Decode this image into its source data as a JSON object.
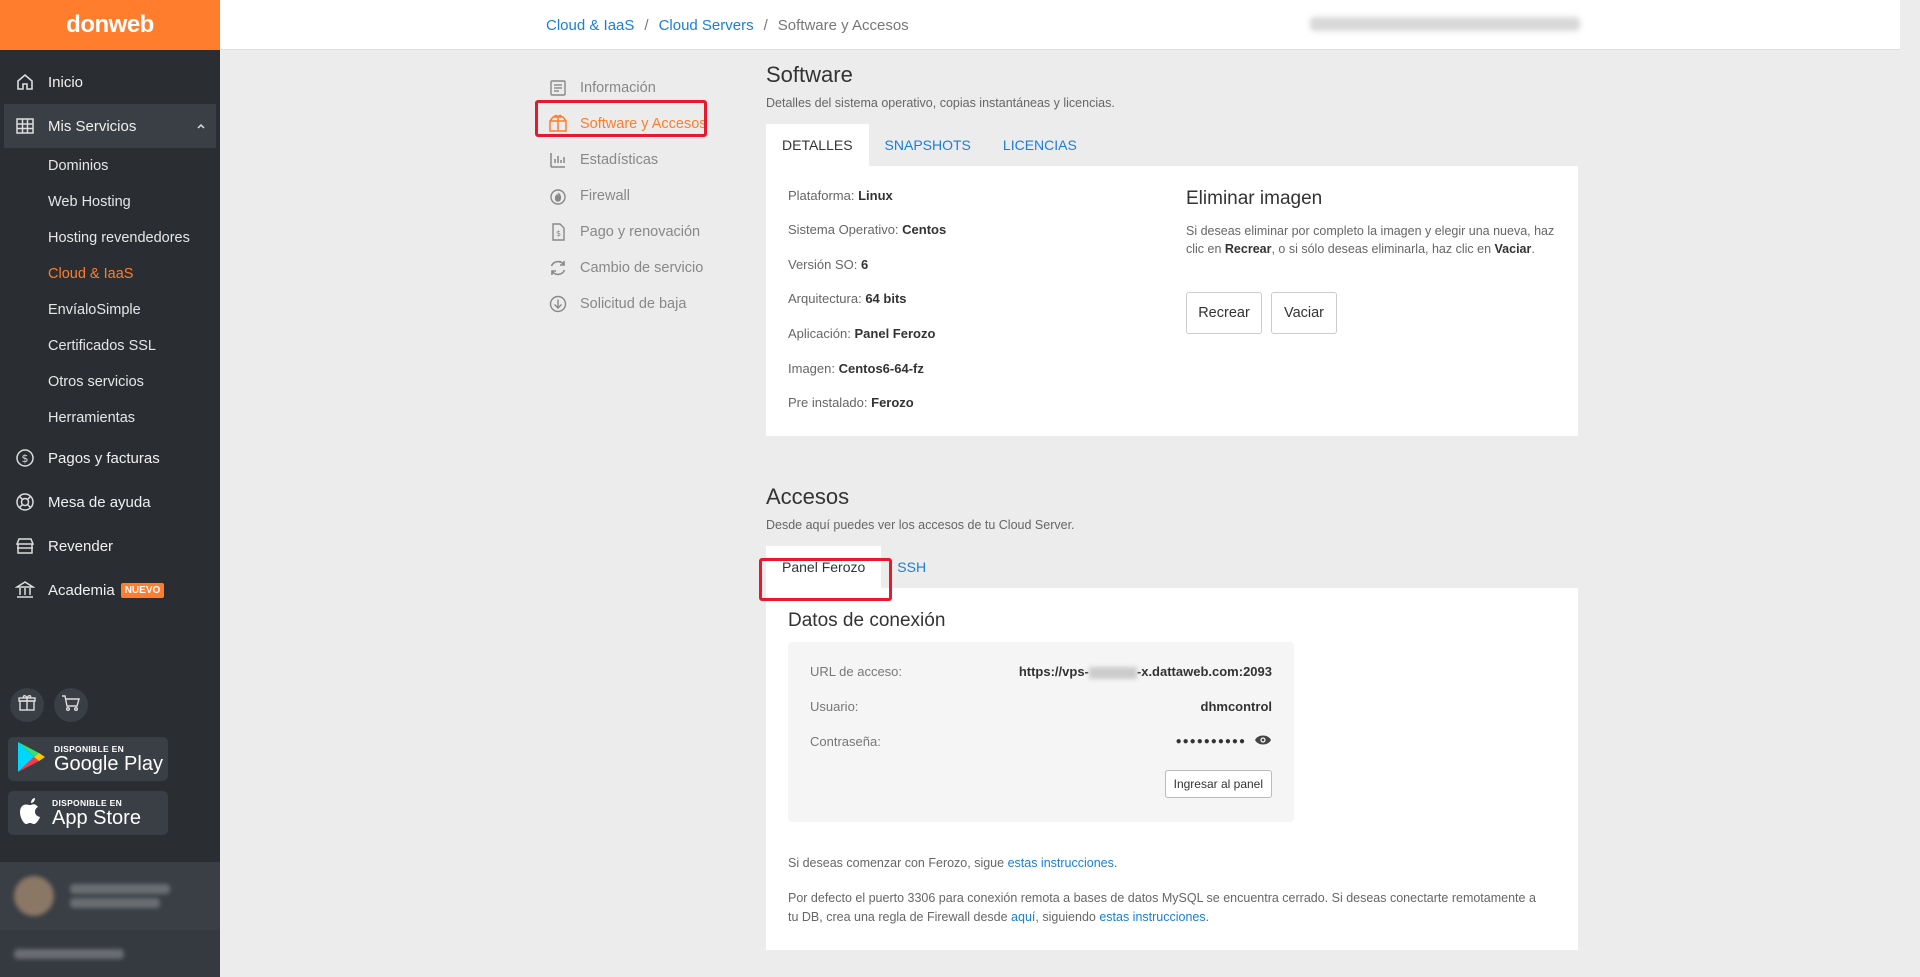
{
  "brand": "donweb",
  "sidebar": {
    "items": [
      {
        "label": "Inicio",
        "icon": "home-icon"
      },
      {
        "label": "Mis Servicios",
        "icon": "grid-icon"
      },
      {
        "label": "Pagos y facturas",
        "icon": "dollar-icon"
      },
      {
        "label": "Mesa de ayuda",
        "icon": "lifebuoy-icon"
      },
      {
        "label": "Revender",
        "icon": "store-icon"
      },
      {
        "label": "Academia",
        "icon": "bank-icon",
        "badge": "NUEVO"
      }
    ],
    "sub_items": [
      "Dominios",
      "Web Hosting",
      "Hosting revendedores",
      "Cloud & IaaS",
      "EnvíaloSimple",
      "Certificados SSL",
      "Otros servicios",
      "Herramientas"
    ],
    "stores": {
      "google": {
        "small": "DISPONIBLE EN",
        "big": "Google Play"
      },
      "apple": {
        "small": "DISPONIBLE EN",
        "big": "App Store"
      }
    }
  },
  "breadcrumb": [
    "Cloud & IaaS",
    "Cloud Servers",
    "Software y Accesos"
  ],
  "subnav": [
    "Información",
    "Software y Accesos",
    "Estadísticas",
    "Firewall",
    "Pago y renovación",
    "Cambio de servicio",
    "Solicitud de baja"
  ],
  "software": {
    "title": "Software",
    "desc": "Detalles del sistema operativo, copias instantáneas y licencias.",
    "tabs": [
      "DETALLES",
      "SNAPSHOTS",
      "LICENCIAS"
    ],
    "details": [
      {
        "label": "Plataforma:",
        "value": "Linux"
      },
      {
        "label": "Sistema Operativo:",
        "value": "Centos"
      },
      {
        "label": "Versión SO:",
        "value": "6"
      },
      {
        "label": "Arquitectura:",
        "value": "64 bits"
      },
      {
        "label": "Aplicación:",
        "value": "Panel Ferozo"
      },
      {
        "label": "Imagen:",
        "value": "Centos6-64-fz"
      },
      {
        "label": "Pre instalado:",
        "value": "Ferozo"
      }
    ],
    "delete": {
      "title": "Eliminar imagen",
      "desc_1": "Si deseas eliminar por completo la imagen y elegir una nueva, haz clic en ",
      "desc_b1": "Recrear",
      "desc_2": ", o si sólo deseas eliminarla, haz clic en ",
      "desc_b2": "Vaciar",
      "desc_3": ".",
      "recreate": "Recrear",
      "empty": "Vaciar"
    }
  },
  "access": {
    "title": "Accesos",
    "desc": "Desde aquí puedes ver los accesos de tu Cloud Server.",
    "tabs": [
      "Panel Ferozo",
      "SSH"
    ],
    "conn_title": "Datos de conexión",
    "url_label": "URL de acceso:",
    "url_prefix": "https://vps-",
    "url_suffix": "-x.dattaweb.com:2093",
    "user_label": "Usuario:",
    "user_value": "dhmcontrol",
    "pass_label": "Contraseña:",
    "pass_value": "●●●●●●●●●●",
    "panel_btn": "Ingresar al panel",
    "note1_text": "Si deseas comenzar con Ferozo, sigue ",
    "note1_link": "estas instrucciones",
    "note1_end": ".",
    "note2_a": "Por defecto el puerto 3306 para conexión remota a bases de datos MySQL se encuentra cerrado. Si deseas conectarte remotamente a tu DB, crea una regla de Firewall desde ",
    "note2_link1": "aquí",
    "note2_b": ", siguiendo ",
    "note2_link2": "estas instrucciones",
    "note2_end": "."
  },
  "colors": {
    "accent": "#ff7d2c",
    "link": "#1a7ed8",
    "sidebar": "#2a2e33",
    "highlight": "#e8192c"
  }
}
